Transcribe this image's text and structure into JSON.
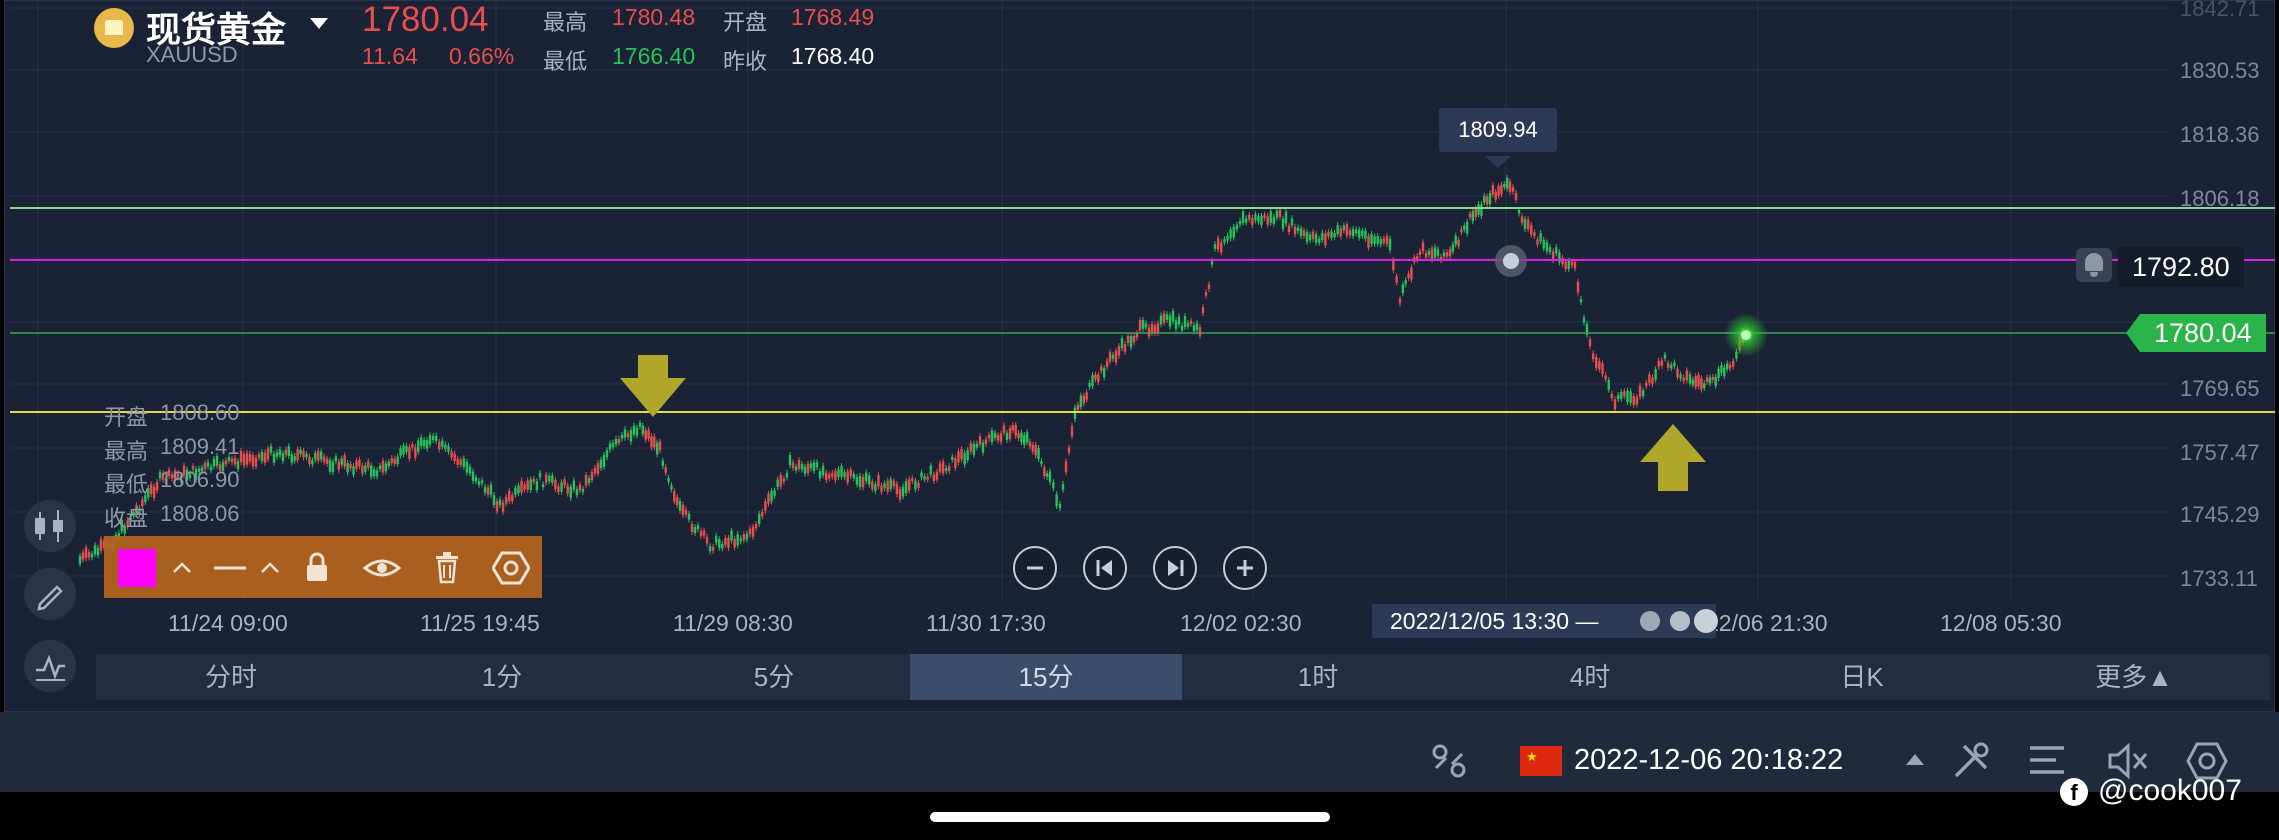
{
  "instrument": {
    "name": "现货黄金",
    "symbol": "XAUUSD",
    "last": "1780.04",
    "change": "11.64",
    "change_pct": "0.66%"
  },
  "stats": {
    "high_label": "最高",
    "high": "1780.48",
    "open_label": "开盘",
    "open": "1768.49",
    "low_label": "最低",
    "low": "1766.40",
    "prev_label": "昨收",
    "prev": "1768.40"
  },
  "ohlc_overlay": {
    "open_label": "开盘",
    "open": "1808.60",
    "high_label": "最高",
    "high": "1809.41",
    "low_label": "最低",
    "low": "1806.90",
    "close_label": "收盘",
    "close": "1808.06"
  },
  "price_axis": [
    "1842.71",
    "1830.53",
    "1818.36",
    "1806.18",
    "1792.80",
    "1780.04",
    "1769.65",
    "1757.47",
    "1745.29",
    "1733.11"
  ],
  "time_axis": [
    "11/24 09:00",
    "11/25 19:45",
    "11/29 08:30",
    "11/30 17:30",
    "12/02 02:30",
    "12/06 21:30",
    "12/08 05:30"
  ],
  "crosshair_time": "2022/12/05 13:30 —",
  "peak_label": "1809.94",
  "alert_price": "1792.80",
  "current_price_tag": "1780.04",
  "timeframes": [
    "分时",
    "1分",
    "5分",
    "15分",
    "1时",
    "4时",
    "日K",
    "更多▲"
  ],
  "active_timeframe": "15分",
  "status": {
    "datetime": "2022-12-06 20:18:22",
    "watermark": "@cook007"
  },
  "colors": {
    "background": "#1a2236",
    "up": "#e84e4e",
    "down": "#26c25a",
    "alert_line": "#e020e0",
    "support_line": "#e6d84a",
    "resistance_line": "#7ee07e",
    "toolbar": "#b5651d"
  }
}
